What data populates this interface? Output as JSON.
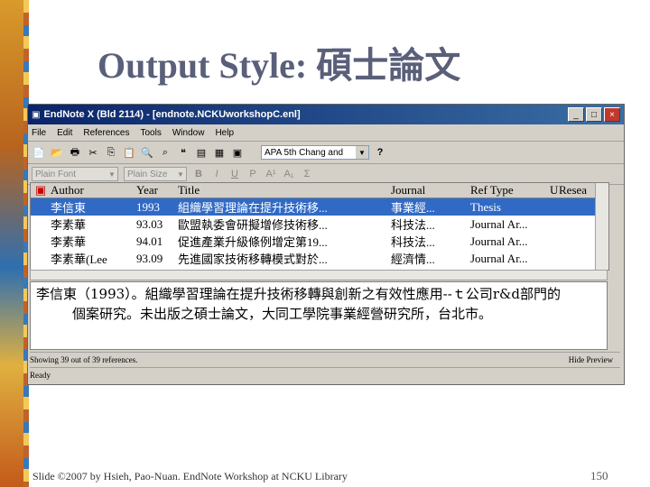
{
  "slide": {
    "title": "Output Style: 碩士論文",
    "footer": "Slide ©2007 by Hsieh, Pao-Nuan. EndNote Workshop at NCKU Library",
    "page_number": "150"
  },
  "window": {
    "title": "EndNote X (Bld 2114) - [endnote.NCKUworkshopC.enl]",
    "controls": [
      "_",
      "□",
      "×"
    ]
  },
  "menu": [
    "File",
    "Edit",
    "References",
    "Tools",
    "Window",
    "Help"
  ],
  "toolbar": {
    "style_value": "APA 5th Chang and"
  },
  "format_bar": {
    "font": "Plain Font",
    "size": "Plain Size",
    "buttons": [
      "B",
      "I",
      "U",
      "P",
      "A¹",
      "A₁",
      "Σ"
    ]
  },
  "table": {
    "headers": [
      "Author",
      "Year",
      "Title",
      "Journal",
      "Ref Type",
      "U",
      "Resea"
    ],
    "rows": [
      [
        "李信東",
        "1993",
        "組織學習理論在提升技術移...",
        "事業經...",
        "Thesis"
      ],
      [
        "李素華",
        "93.03",
        "歐盟執委會研擬增修技術移...",
        "科技法...",
        "Journal Ar..."
      ],
      [
        "李素華",
        "94.01",
        "促進產業升級條例增定第19...",
        "科技法...",
        "Journal Ar..."
      ],
      [
        "李素華(Lee",
        "93.09",
        "先進國家技術移轉模式對於...",
        "經濟情...",
        "Journal Ar..."
      ]
    ]
  },
  "preview": {
    "line1": "李信東（1993）。組織學習理論在提升技術移轉與創新之有效性應用--ｔ公司r&d部門的",
    "line2": "個案研究。未出版之碩士論文，大同工學院事業經營研究所，台北市。"
  },
  "status": {
    "count": "Showing 39 out of 39 references.",
    "hide_preview": "Hide Preview",
    "ready": "Ready"
  }
}
